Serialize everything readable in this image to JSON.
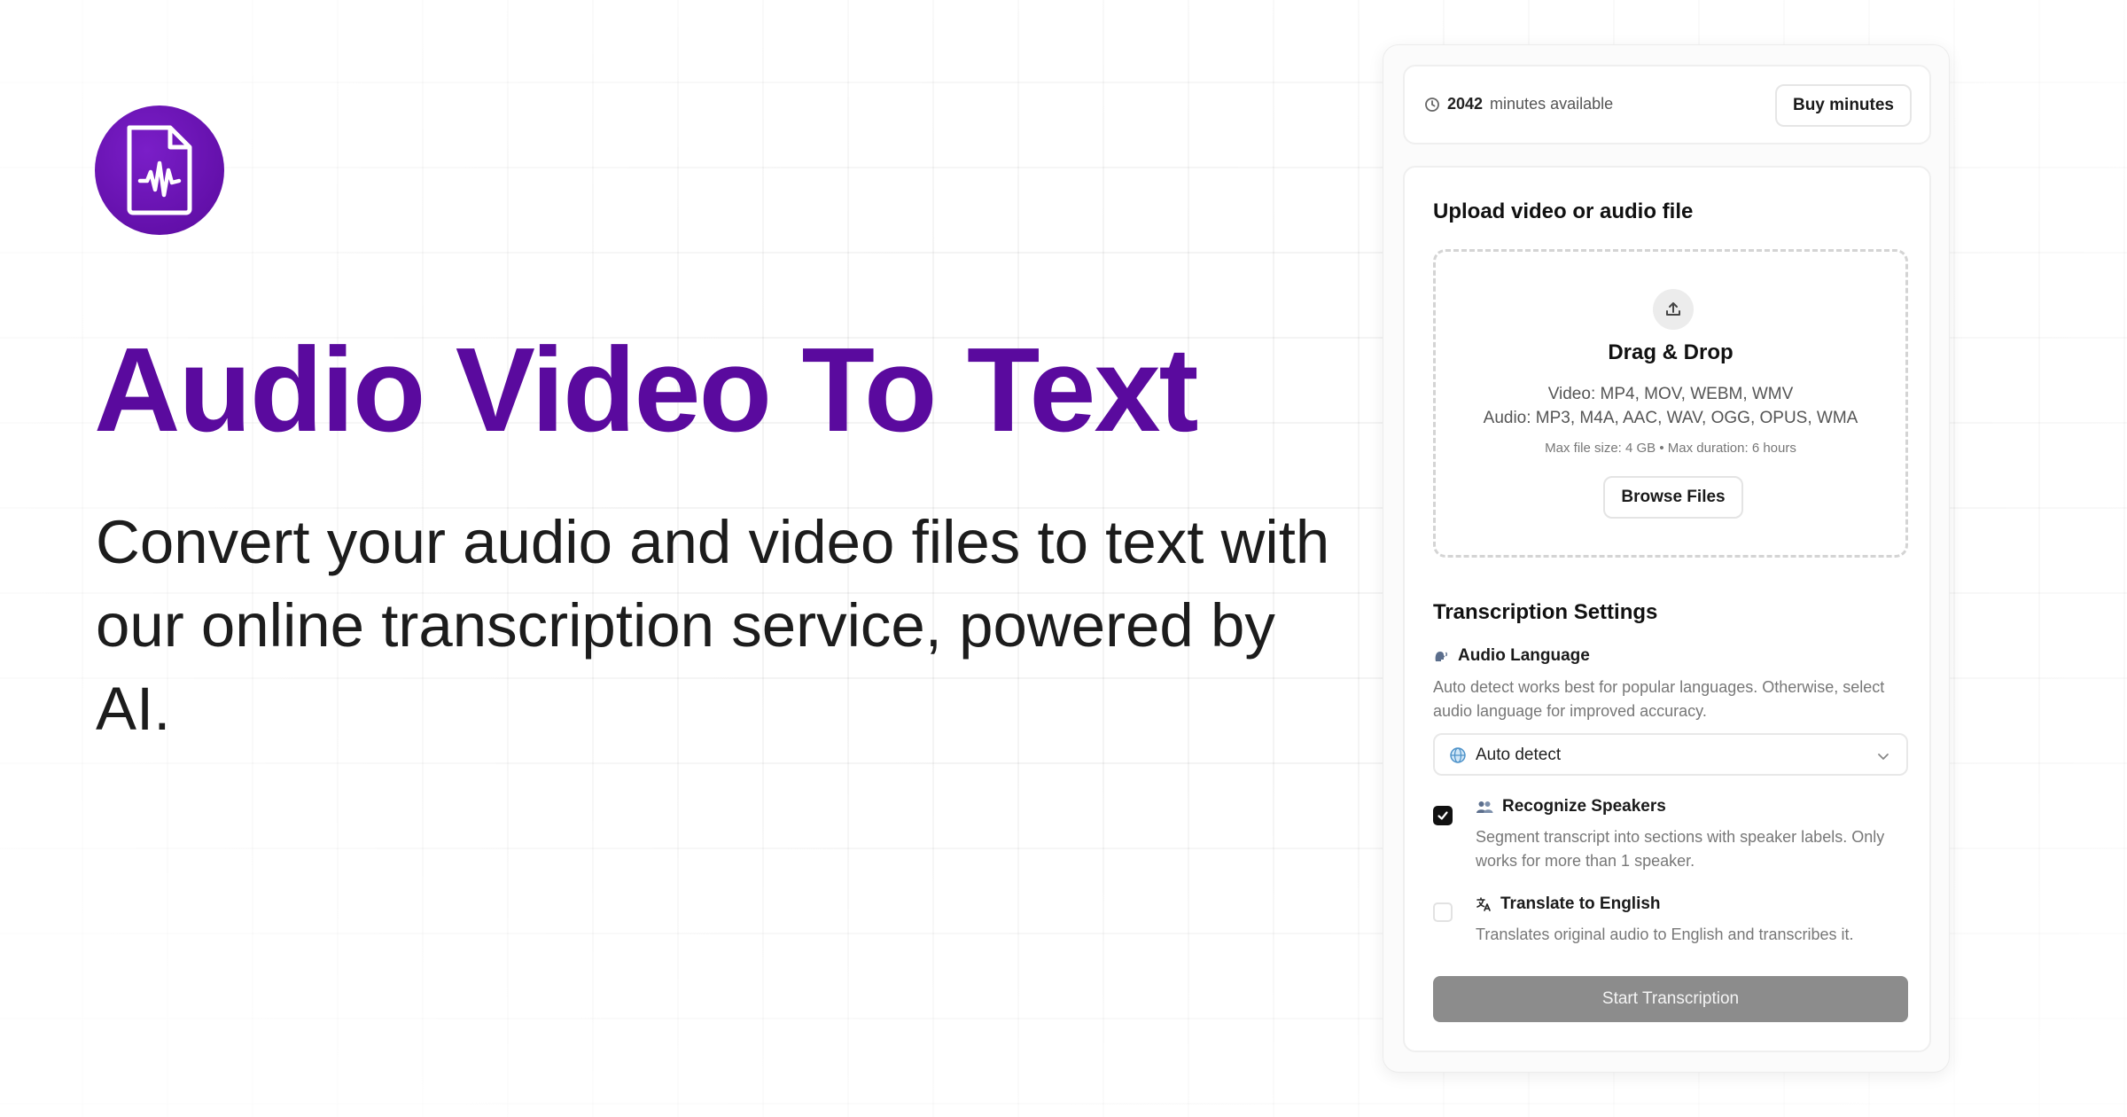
{
  "hero": {
    "title": "Audio Video To Text",
    "subtitle": "Convert your audio and video files to text with our online transcription service, powered by AI."
  },
  "minutes": {
    "count": "2042",
    "label": "minutes available",
    "buy_button": "Buy minutes"
  },
  "upload": {
    "heading": "Upload video or audio file",
    "drop_title": "Drag & Drop",
    "video_formats": "Video: MP4, MOV, WEBM, WMV",
    "audio_formats": "Audio: MP3, M4A, AAC, WAV, OGG, OPUS, WMA",
    "limits": "Max file size: 4 GB • Max duration: 6 hours",
    "browse_button": "Browse Files"
  },
  "settings": {
    "heading": "Transcription Settings",
    "language": {
      "label": "Audio Language",
      "description": "Auto detect works best for popular languages. Otherwise, select audio language for improved accuracy.",
      "selected": "Auto detect"
    },
    "speakers": {
      "label": "Recognize Speakers",
      "description": "Segment transcript into sections with speaker labels. Only works for more than 1 speaker.",
      "checked": true
    },
    "translate": {
      "label": "Translate to English",
      "description": "Translates original audio to English and transcribes it.",
      "checked": false
    }
  },
  "start_button": "Start Transcription",
  "colors": {
    "brand": "#5a0a9e",
    "start_button_disabled": "#8c8c8c"
  },
  "icons": {
    "logo": "audio-file-waveform-icon",
    "clock": "clock-icon",
    "upload": "upload-icon",
    "language": "speaking-head-icon",
    "globe": "globe-icon",
    "chevron": "chevron-down-icon",
    "speakers": "people-icon",
    "translate": "translate-icon",
    "check": "check-icon"
  }
}
